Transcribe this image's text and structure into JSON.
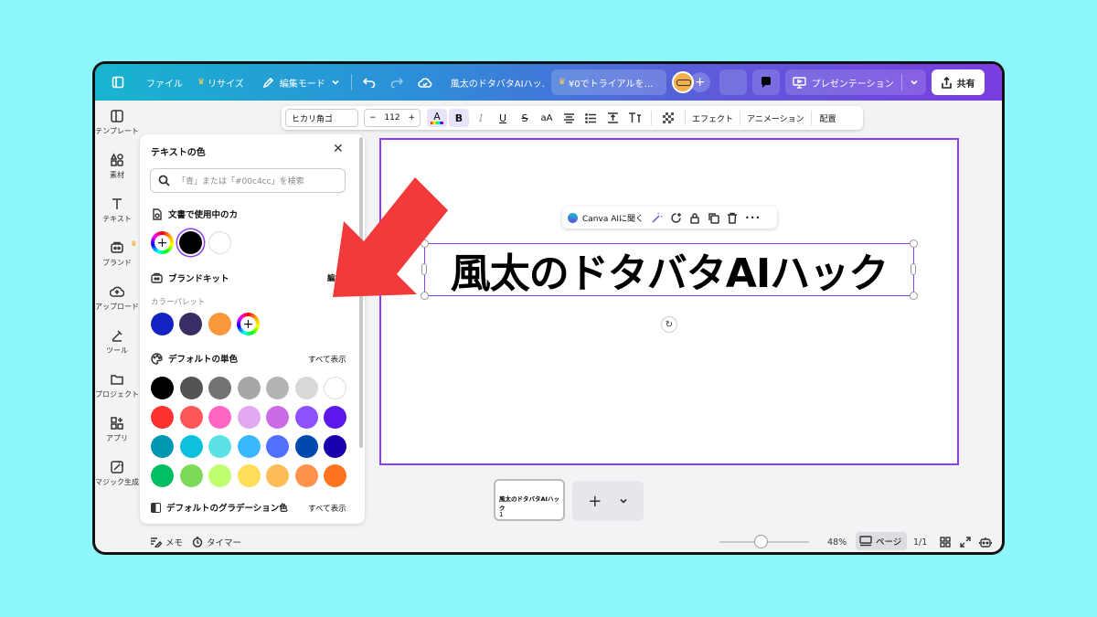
{
  "topbar": {
    "file": "ファイル",
    "resize": "リサイズ",
    "edit_mode": "編集モード",
    "doc_title": "風太のドタバタAIハッ…",
    "trial": "¥0でトライアルを…",
    "present": "プレゼンテーション",
    "share": "共有"
  },
  "leftnav": [
    {
      "label": "テンプレート",
      "icon": "template-icon"
    },
    {
      "label": "素材",
      "icon": "elements-icon"
    },
    {
      "label": "テキスト",
      "icon": "text-icon"
    },
    {
      "label": "ブランド",
      "icon": "brand-icon"
    },
    {
      "label": "アップロード",
      "icon": "upload-icon"
    },
    {
      "label": "ツール",
      "icon": "tools-icon"
    },
    {
      "label": "プロジェクト",
      "icon": "folder-icon"
    },
    {
      "label": "アプリ",
      "icon": "apps-icon"
    },
    {
      "label": "マジック生成",
      "icon": "magic-icon"
    }
  ],
  "panel": {
    "title": "テキストの色",
    "search_placeholder": "「青」または「#00c4cc」を検索",
    "doc_colors_title": "文書で使用中のカ",
    "brand_kit_title": "ブランドキット",
    "brand_kit_edit": "編集",
    "palette_label": "カラーパレット",
    "default_solid_title": "デフォルトの単色",
    "show_all": "すべて表示",
    "gradient_title": "デフォルトのグラデーション色",
    "gradient_show_all": "すべて表示",
    "doc_colors": [
      "#000000",
      "#ffffff"
    ],
    "brand_colors": [
      "#1323c4",
      "#3a2d66",
      "#f9973a"
    ],
    "default_colors": [
      [
        "#000000",
        "#545454",
        "#737373",
        "#a6a6a6",
        "#b4b4b4",
        "#d9d9d9",
        "#ffffff"
      ],
      [
        "#ff3131",
        "#ff5757",
        "#ff66c4",
        "#e2a9f1",
        "#cb6ce6",
        "#8c52ff",
        "#5e17eb"
      ],
      [
        "#0097b2",
        "#0cc0df",
        "#5ce1e6",
        "#38b6ff",
        "#5271ff",
        "#004aad",
        "#1800ad"
      ],
      [
        "#00bf63",
        "#7ed957",
        "#c1ff72",
        "#ffde59",
        "#ffbd59",
        "#ff914d",
        "#ff751f"
      ]
    ]
  },
  "toolbar": {
    "font": "ヒカリ角ゴ",
    "minus": "−",
    "size": "112",
    "plus": "+",
    "text_color_glyph": "A",
    "bold": "B",
    "italic": "I",
    "underline": "U",
    "strike": "S",
    "case": "aA",
    "effects": "エフェクト",
    "animation": "アニメーション",
    "position": "配置"
  },
  "context_menu": {
    "ask_ai": "Canva AIに聞く",
    "more": "•••"
  },
  "canvas": {
    "main_text": "風太のドタバタAIハック"
  },
  "pages": {
    "thumb_text": "風太のドタバタAIハック",
    "thumb_number": "1",
    "add": "+"
  },
  "bottom": {
    "memo": "メモ",
    "timer": "タイマー",
    "zoom": "48%",
    "zoom_level": 0.48,
    "page_label": "ページ",
    "page_count": "1/1"
  },
  "colors": {
    "accent": "#8b3dff",
    "arrow": "#f23a3a",
    "background": "#8cf6fb"
  }
}
